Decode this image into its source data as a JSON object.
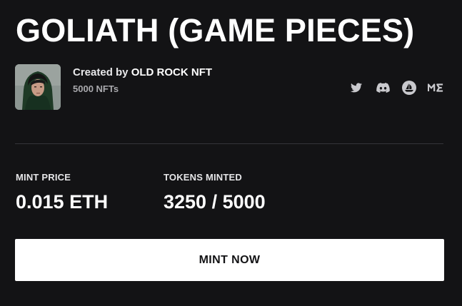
{
  "collection": {
    "title": "GOLIATH (GAME PIECES)",
    "created_by_prefix": "Created by",
    "creator_name": "OLD ROCK NFT",
    "nft_count": "5000 NFTs"
  },
  "socials": [
    {
      "icon": "twitter-icon"
    },
    {
      "icon": "discord-icon"
    },
    {
      "icon": "opensea-icon"
    },
    {
      "icon": "magic-eden-icon"
    }
  ],
  "stats": {
    "mint_price_label": "MINT PRICE",
    "mint_price_value": "0.015 ETH",
    "tokens_minted_label": "TOKENS MINTED",
    "tokens_minted_value": "3250 / 5000"
  },
  "actions": {
    "mint_label": "MINT NOW"
  },
  "colors": {
    "background": "#131315",
    "text": "#ffffff",
    "muted": "#a9a9ad",
    "icon": "#c9c9cd",
    "button_bg": "#ffffff",
    "button_text": "#131315"
  }
}
